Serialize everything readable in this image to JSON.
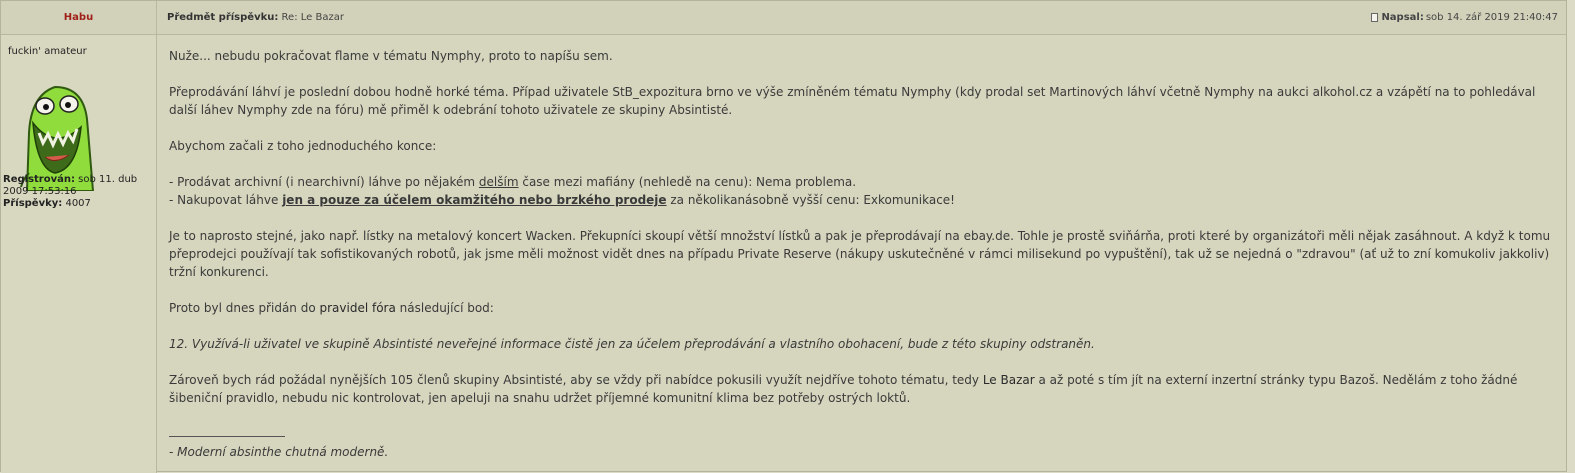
{
  "author": {
    "name": "Habu",
    "rank": "fuckin' amateur"
  },
  "profile": {
    "registered_label": "Registrován:",
    "registered_value": " sob 11. dub 2009 17:53:16",
    "posts_label": "Příspěvky:",
    "posts_value": " 4007"
  },
  "header": {
    "subject_label": "Předmět příspěvku:",
    "subject_value": " Re: Le Bazar",
    "posted_label": "Napsal:",
    "posted_value": " sob 14. zář 2019 21:40:47"
  },
  "post": {
    "p1": "Nuže... nebudu pokračovat flame v tématu Nymphy, proto to napíšu sem.",
    "p2": "Přeprodávání láhví je poslední dobou hodně horké téma. Případ uživatele StB_expozitura brno ve výše zmíněném tématu Nymphy (kdy prodal set Martinových láhví včetně Nymphy na aukci alkohol.cz a vzápětí na to pohledával další láhev Nymphy zde na fóru) mě přiměl k odebrání tohoto uživatele ze skupiny Absintisté.",
    "p3": "Abychom začali z toho jednoduchého konce:",
    "b1_a": "- Prodávat archivní (i nearchivní) láhve po nějakém ",
    "b1_u": "delším",
    "b1_b": " čase mezi mafiány (nehledě na cenu): Nema problema.",
    "b2_a": "- Nakupovat láhve ",
    "b2_u": "jen a pouze za účelem okamžitého nebo brzkého prodeje",
    "b2_b": " za několikanásobně vyšší cenu: Exkomunikace!",
    "p4": "Je to naprosto stejné, jako např. lístky na metalový koncert Wacken. Překupníci skoupí větší množství lístků a pak je přeprodávají na ebay.de. Tohle je prostě sviňárňa, proti které by organizátoři měli nějak zasáhnout. A když k tomu přeprodejci používají tak sofistikovaných robotů, jak jsme měli možnost vidět dnes na případu Private Reserve (nákupy uskutečněné v rámci milisekund po vypuštění), tak už se nejedná o \"zdravou\" (ať už to zní komukoliv jakkoliv) tržní konkurenci.",
    "p5_a": "Proto byl dnes přidán do ",
    "p5_link": "pravidel fóra",
    "p5_b": " následující bod:",
    "rule": "12. Využívá-li uživatel ve skupině Absintisté neveřejné informace čistě jen za účelem přeprodávání a vlastního obohacení, bude z této skupiny odstraněn.",
    "p6_a": "Zároveň bych rád požádal nynějších 105 členů skupiny Absintisté, aby se vždy při nabídce pokusili využít nejdříve tohoto tématu, tedy ",
    "p6_link": "Le Bazar",
    "p6_b": " a až poté s tím jít na externí inzertní stránky typu Bazoš. Nedělám z toho žádné šibeniční pravidlo, nebudu nic kontrolovat, jen apeluji na snahu udržet příjemné komunitní klima bez potřeby ostrých loktů.",
    "signature": "- Moderní absinthe chutná moderně."
  },
  "icons": {
    "post_icon": "document-icon",
    "avatar": "green-monster-avatar"
  },
  "colors": {
    "author_name": "#a0211a",
    "background": "#d6d6bf",
    "avatar_green": "#8fdc3c"
  }
}
